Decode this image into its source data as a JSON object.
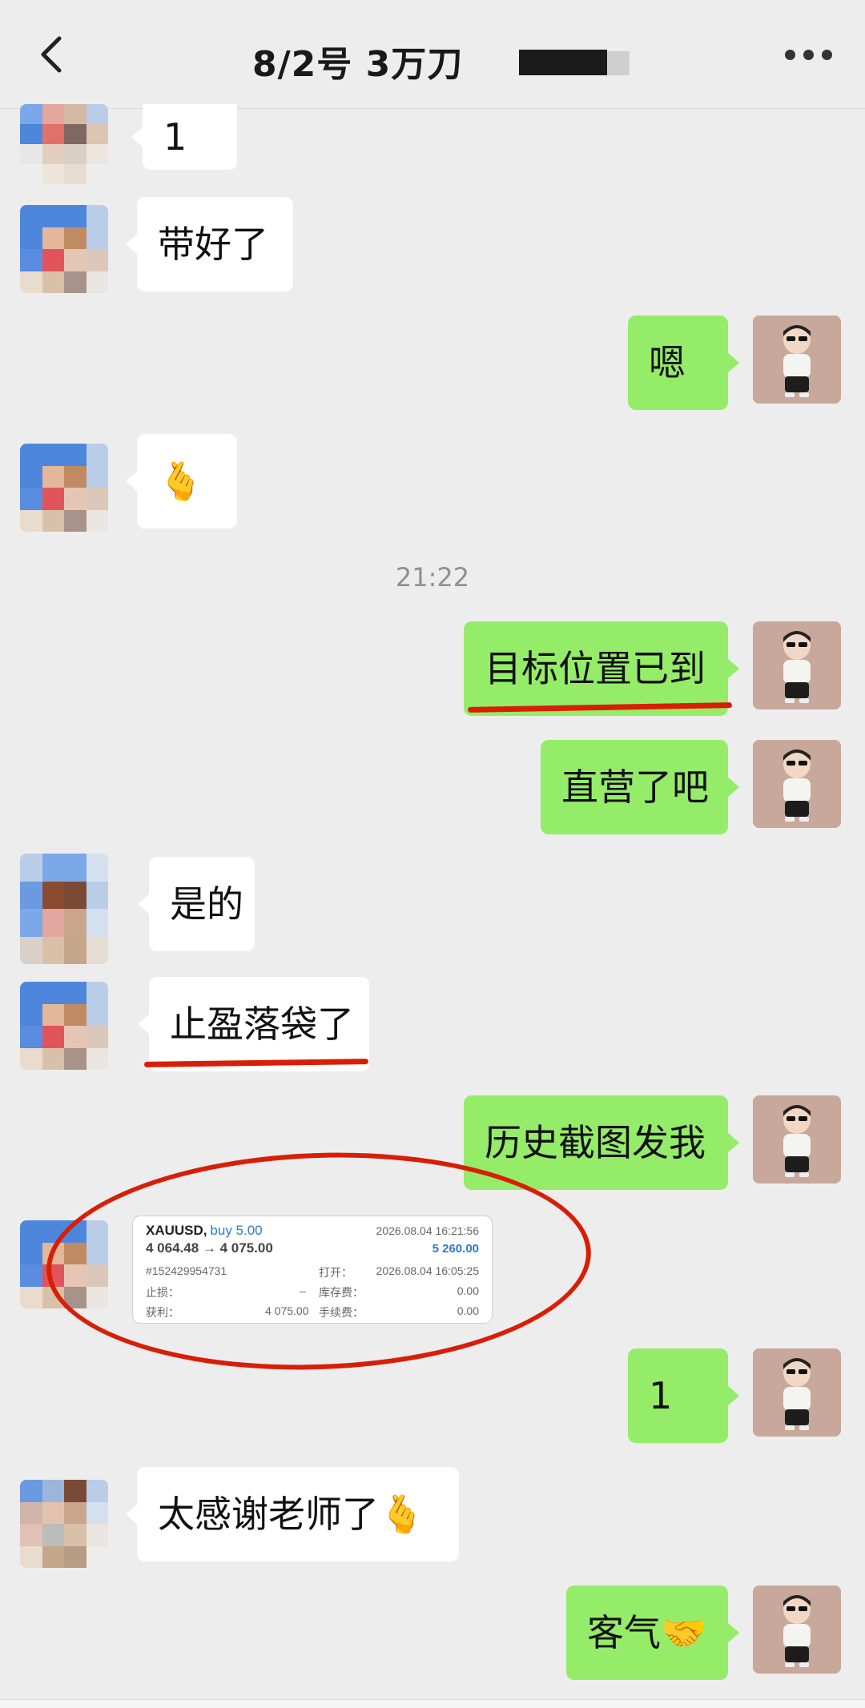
{
  "header": {
    "title": "8/2号  3万刀"
  },
  "timestamp": "21:22",
  "messages": [
    {
      "side": "left",
      "text": "1"
    },
    {
      "side": "left",
      "text": "带好了"
    },
    {
      "side": "right",
      "text": "嗯"
    },
    {
      "side": "left",
      "text": "🫰"
    },
    {
      "side": "right",
      "text": "目标位置已到"
    },
    {
      "side": "right",
      "text": "直营了吧"
    },
    {
      "side": "left",
      "text": "是的"
    },
    {
      "side": "left",
      "text": "止盈落袋了"
    },
    {
      "side": "right",
      "text": "历史截图发我"
    },
    {
      "side": "right",
      "text": "1"
    },
    {
      "side": "left",
      "text": "太感谢老师了🫰"
    },
    {
      "side": "right",
      "text": "客气🤝"
    }
  ],
  "trade_card": {
    "symbol": "XAUUSD,",
    "side": "buy 5.00",
    "datetime_close": "2026.08.04 16:21:56",
    "prices": "4 064.48 → 4 075.00",
    "profit": "5 260.00",
    "order_id": "#152429954731",
    "open_label": "打开：",
    "datetime_open": "2026.08.04 16:05:25",
    "sl_label": "止损：",
    "sl_value": "–",
    "swap_label": "库存费：",
    "swap_value": "0.00",
    "tp_label": "获利：",
    "tp_value": "4 075.00",
    "fee_label": "手续费：",
    "fee_value": "0.00"
  },
  "colors": {
    "green_bubble": "#95ec69",
    "white_bubble": "#ffffff",
    "highlight": "#d81e06",
    "background": "#ededed"
  },
  "icons": [
    "back-arrow-icon",
    "more-icon"
  ]
}
